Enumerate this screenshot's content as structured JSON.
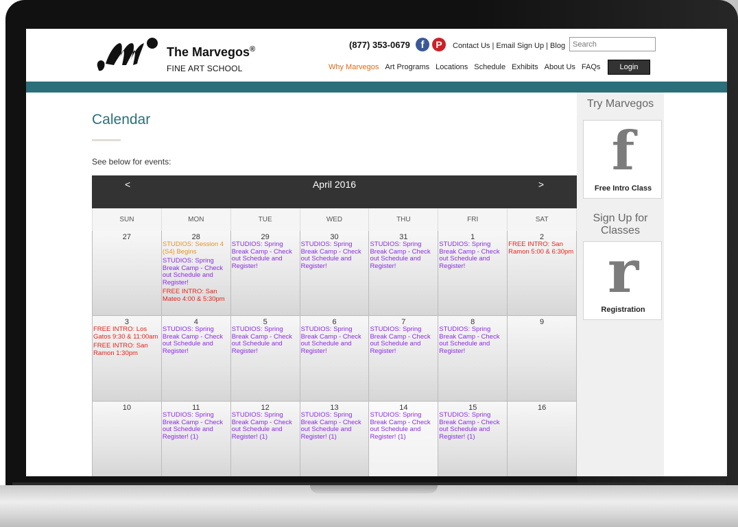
{
  "header": {
    "brand": "The Marvegos",
    "brand_reg": "®",
    "brand_sub": "FINE ART SCHOOL",
    "phone": "(877) 353-0679",
    "facebook_glyph": "f",
    "pinterest_glyph": "P",
    "top_links": "Contact Us | Email Sign Up | Blog",
    "search_placeholder": "Search",
    "nav": [
      {
        "label": "Why Marvegos",
        "active": true
      },
      {
        "label": "Art Programs"
      },
      {
        "label": "Locations"
      },
      {
        "label": "Schedule"
      },
      {
        "label": "Exhibits"
      },
      {
        "label": "About Us"
      },
      {
        "label": "FAQs"
      }
    ],
    "login_label": "Login"
  },
  "page": {
    "title": "Calendar",
    "subtitle": "See below for events:"
  },
  "calendar": {
    "prev": "<",
    "month": "April 2016",
    "next": ">",
    "weekdays": [
      "SUN",
      "MON",
      "TUE",
      "WED",
      "THU",
      "FRI",
      "SAT"
    ],
    "weeks": [
      {
        "height": 124,
        "days": [
          {
            "num": "27",
            "events": []
          },
          {
            "num": "28",
            "events": [
              {
                "text": "STUDIOS: Session 4 (S4) Begins",
                "color": "orange"
              },
              {
                "text": "STUDIOS: Spring Break Camp - Check out Schedule and Register!",
                "color": "purple"
              },
              {
                "text": "FREE INTRO: San Mateo 4:00 & 5:30pm",
                "color": "red"
              }
            ]
          },
          {
            "num": "29",
            "events": [
              {
                "text": "STUDIOS: Spring Break Camp - Check out Schedule and Register!",
                "color": "purple"
              }
            ]
          },
          {
            "num": "30",
            "events": [
              {
                "text": "STUDIOS: Spring Break Camp - Check out Schedule and Register!",
                "color": "purple"
              }
            ]
          },
          {
            "num": "31",
            "events": [
              {
                "text": "STUDIOS: Spring Break Camp - Check out Schedule and Register!",
                "color": "purple"
              }
            ]
          },
          {
            "num": "1",
            "events": [
              {
                "text": "STUDIOS: Spring Break Camp - Check out Schedule and Register!",
                "color": "purple"
              }
            ]
          },
          {
            "num": "2",
            "events": [
              {
                "text": "FREE INTRO: San Ramon 5:00 & 6:30pm",
                "color": "red"
              }
            ]
          }
        ]
      },
      {
        "height": 125,
        "days": [
          {
            "num": "3",
            "events": [
              {
                "text": "FREE INTRO: Los Gatos 9:30 & 11:00am",
                "color": "red"
              },
              {
                "text": "FREE INTRO: San Ramon 1:30pm",
                "color": "red"
              }
            ]
          },
          {
            "num": "4",
            "events": [
              {
                "text": "STUDIOS: Spring Break Camp - Check out Schedule and Register!",
                "color": "purple"
              }
            ]
          },
          {
            "num": "5",
            "events": [
              {
                "text": "STUDIOS: Spring Break Camp - Check out Schedule and Register!",
                "color": "purple"
              }
            ]
          },
          {
            "num": "6",
            "events": [
              {
                "text": "STUDIOS: Spring Break Camp - Check out Schedule and Register!",
                "color": "purple"
              }
            ]
          },
          {
            "num": "7",
            "events": [
              {
                "text": "STUDIOS: Spring Break Camp - Check out Schedule and Register!",
                "color": "purple"
              }
            ]
          },
          {
            "num": "8",
            "events": [
              {
                "text": "STUDIOS: Spring Break Camp - Check out Schedule and Register!",
                "color": "purple"
              }
            ]
          },
          {
            "num": "9",
            "events": []
          }
        ]
      },
      {
        "height": 110,
        "days": [
          {
            "num": "10",
            "events": []
          },
          {
            "num": "11",
            "events": [
              {
                "text": "STUDIOS: Spring Break Camp - Check out Schedule and Register! (1)",
                "color": "purple"
              }
            ]
          },
          {
            "num": "12",
            "events": [
              {
                "text": "STUDIOS: Spring Break Camp - Check out Schedule and Register! (1)",
                "color": "purple"
              }
            ]
          },
          {
            "num": "13",
            "events": [
              {
                "text": "STUDIOS: Spring Break Camp - Check out Schedule and Register! (1)",
                "color": "purple"
              }
            ]
          },
          {
            "num": "14",
            "today": true,
            "events": [
              {
                "text": "STUDIOS: Spring Break Camp - Check out Schedule and Register! (1)",
                "color": "purple"
              }
            ]
          },
          {
            "num": "15",
            "events": [
              {
                "text": "STUDIOS: Spring Break Camp - Check out Schedule and Register! (1)",
                "color": "purple"
              }
            ]
          },
          {
            "num": "16",
            "events": []
          }
        ]
      }
    ]
  },
  "sidebar": {
    "try_title": "Try Marvegos",
    "try_glyph": "f",
    "try_label": "Free Intro Class",
    "signup_title_1": "Sign Up for",
    "signup_title_2": "Classes",
    "signup_glyph": "r",
    "signup_label": "Registration"
  },
  "colors": {
    "teal": "#2a6f7a",
    "nav_active": "#e06a14",
    "event_purple": "#8a2be2",
    "event_orange": "#e6921e",
    "event_red": "#e5231b"
  }
}
